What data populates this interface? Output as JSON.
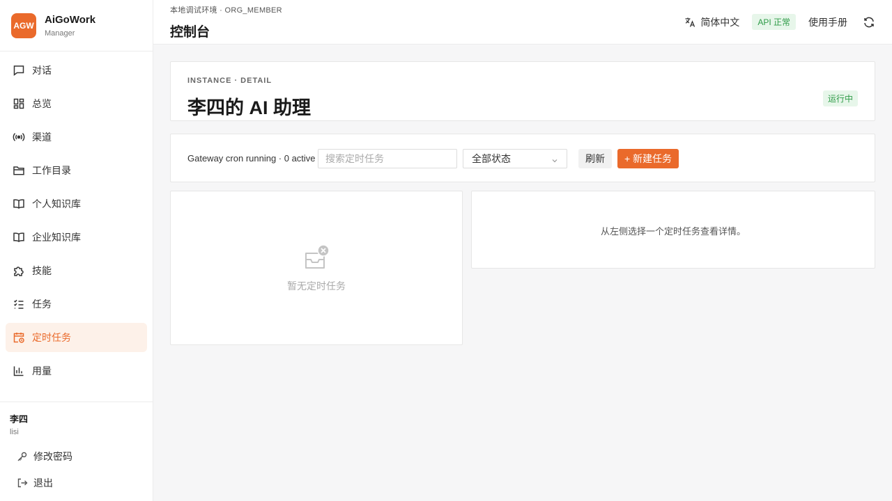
{
  "brand": {
    "logo": "AGW",
    "name": "AiGoWork",
    "role": "Manager",
    "accent": "#ea6a2b"
  },
  "nav": {
    "items": [
      {
        "label": "对话",
        "icon": "chat-icon"
      },
      {
        "label": "总览",
        "icon": "dashboard-icon"
      },
      {
        "label": "渠道",
        "icon": "broadcast-icon"
      },
      {
        "label": "工作目录",
        "icon": "folder-icon"
      },
      {
        "label": "个人知识库",
        "icon": "book-icon"
      },
      {
        "label": "企业知识库",
        "icon": "book-icon"
      },
      {
        "label": "技能",
        "icon": "puzzle-icon"
      },
      {
        "label": "任务",
        "icon": "checklist-icon"
      },
      {
        "label": "定时任务",
        "icon": "calendar-clock-icon",
        "active": true
      },
      {
        "label": "用量",
        "icon": "bar-chart-icon"
      }
    ]
  },
  "user": {
    "name": "李四",
    "id": "lisi",
    "change_password": "修改密码",
    "logout": "退出"
  },
  "header": {
    "env": "本地调试环境 · ORG_MEMBER",
    "title": "控制台",
    "language": "简体中文",
    "api_status": "API 正常",
    "manual": "使用手册"
  },
  "instance": {
    "kicker": "INSTANCE · DETAIL",
    "title": "李四的 AI 助理",
    "status": "运行中"
  },
  "toolbar": {
    "cron_status": "Gateway cron running · 0 active",
    "search_placeholder": "搜索定时任务",
    "status_filter": "全部状态",
    "refresh": "刷新",
    "new_task": "+ 新建任务"
  },
  "list": {
    "empty_text": "暂无定时任务"
  },
  "detail": {
    "hint": "从左侧选择一个定时任务查看详情。"
  }
}
